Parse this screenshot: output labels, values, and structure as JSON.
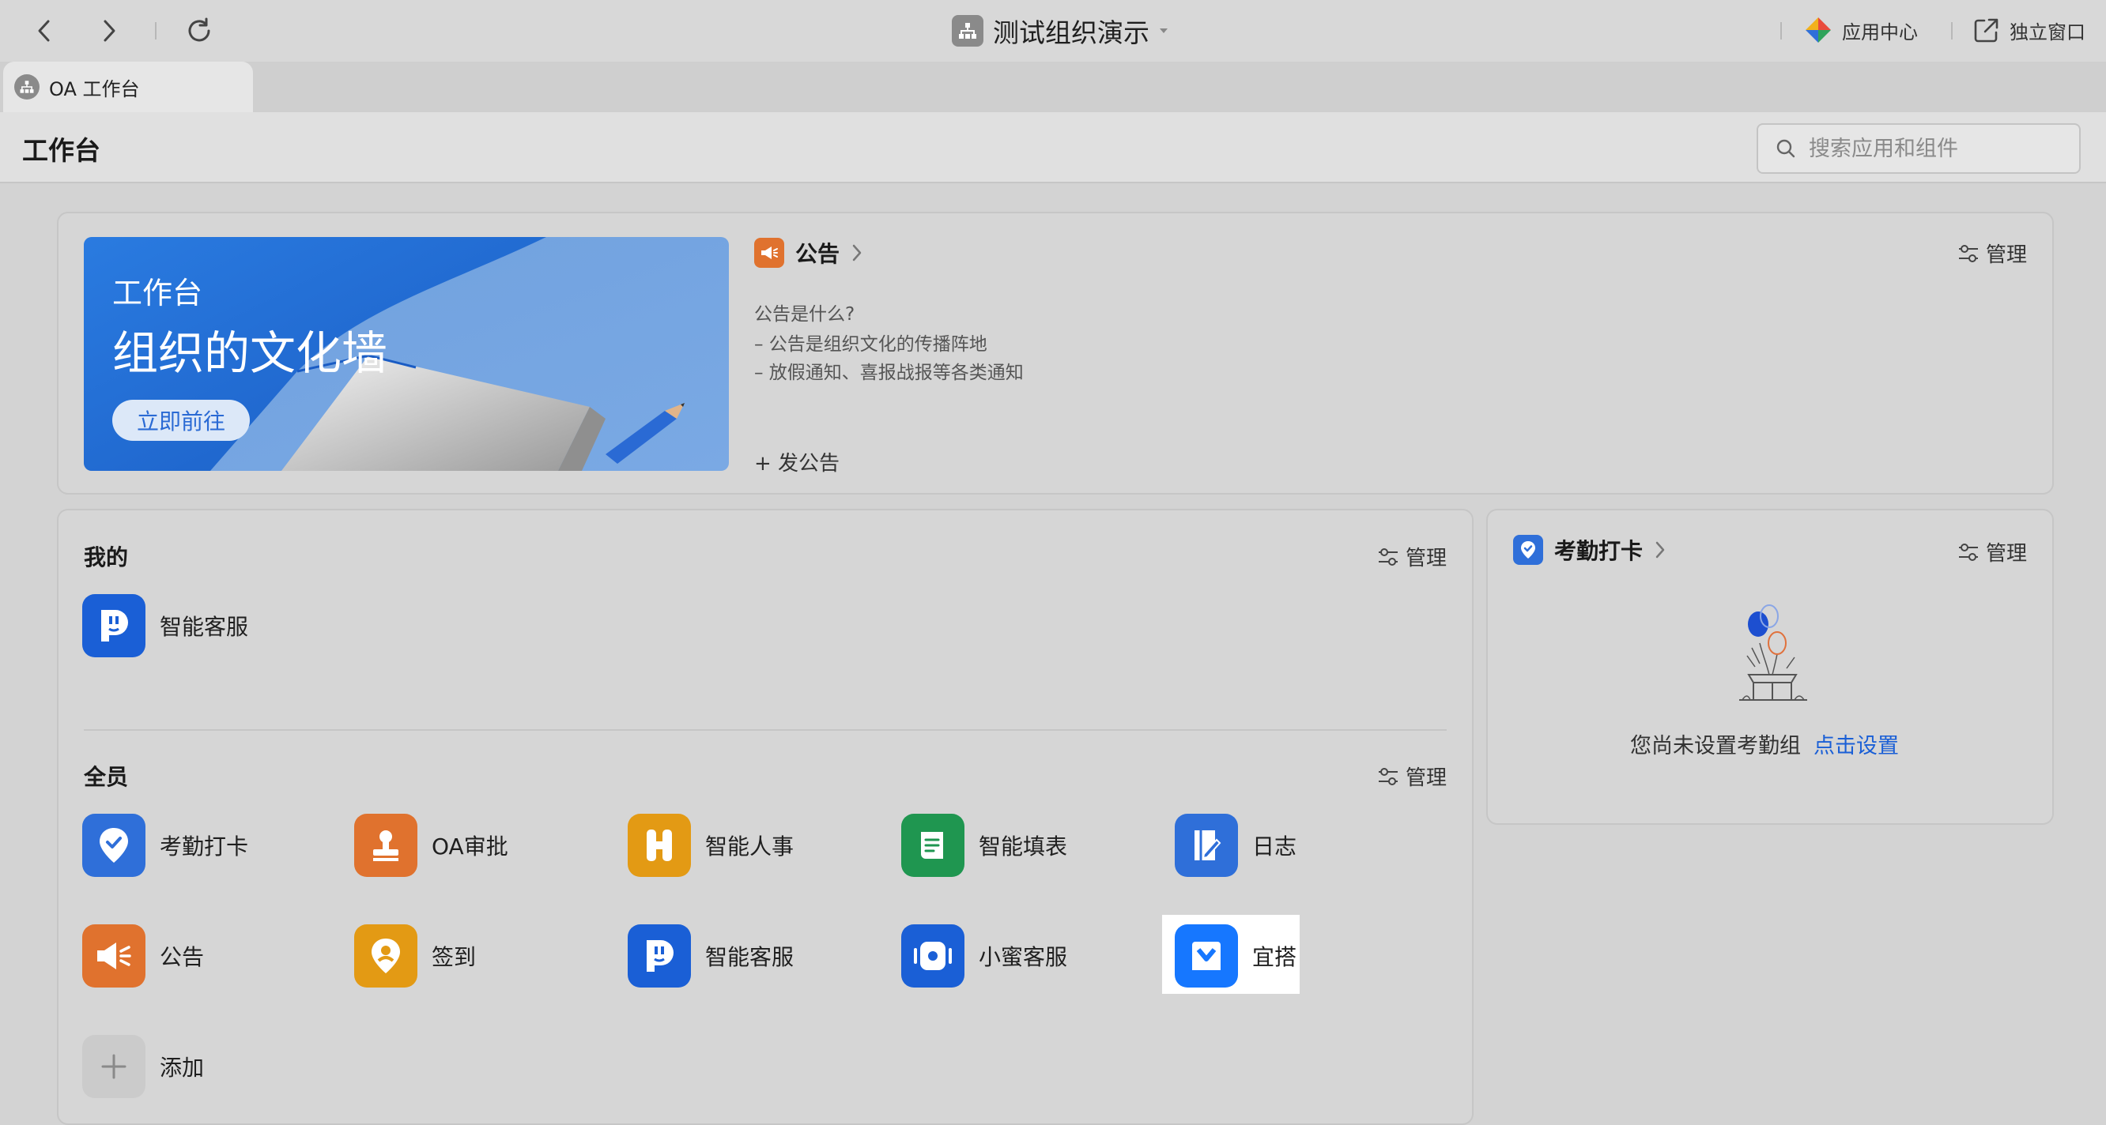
{
  "window": {
    "org_title": "测试组织演示",
    "app_center_label": "应用中心",
    "standalone_window_label": "独立窗口"
  },
  "tab": {
    "label": "OA 工作台"
  },
  "header": {
    "title": "工作台",
    "search_placeholder": "搜索应用和组件"
  },
  "banner": {
    "kicker": "工作台",
    "headline": "组织的文化墙",
    "button_label": "立即前往"
  },
  "announcement": {
    "title": "公告",
    "manage_label": "管理",
    "lines": [
      "公告是什么?",
      "– 公告是组织文化的传播阵地",
      "– 放假通知、喜报战报等各类通知"
    ],
    "post_label": "+ 发公告"
  },
  "mine": {
    "title": "我的",
    "manage_label": "管理",
    "apps": [
      {
        "label": "智能客服",
        "icon": "smart-service-icon",
        "color": "#1a5fd6"
      }
    ]
  },
  "all": {
    "title": "全员",
    "manage_label": "管理",
    "apps": [
      {
        "label": "考勤打卡",
        "icon": "location-check-icon",
        "color": "#2f6fd9"
      },
      {
        "label": "OA审批",
        "icon": "stamp-icon",
        "color": "#e0722e"
      },
      {
        "label": "智能人事",
        "icon": "h-letter-icon",
        "color": "#e39a14"
      },
      {
        "label": "智能填表",
        "icon": "form-icon",
        "color": "#1f9650"
      },
      {
        "label": "日志",
        "icon": "log-pen-icon",
        "color": "#2f6fd9"
      },
      {
        "label": "公告",
        "icon": "megaphone-icon",
        "color": "#e0722e"
      },
      {
        "label": "签到",
        "icon": "location-pin-icon",
        "color": "#e39a14"
      },
      {
        "label": "智能客服",
        "icon": "smart-service-icon",
        "color": "#1a5fd6"
      },
      {
        "label": "小蜜客服",
        "icon": "speaker-icon",
        "color": "#1a5fd6"
      },
      {
        "label": "宜搭",
        "icon": "yida-icon",
        "color": "#1677ff"
      }
    ],
    "add_label": "添加"
  },
  "attendance": {
    "title": "考勤打卡",
    "manage_label": "管理",
    "empty_text": "您尚未设置考勤组",
    "setup_link": "点击设置"
  }
}
